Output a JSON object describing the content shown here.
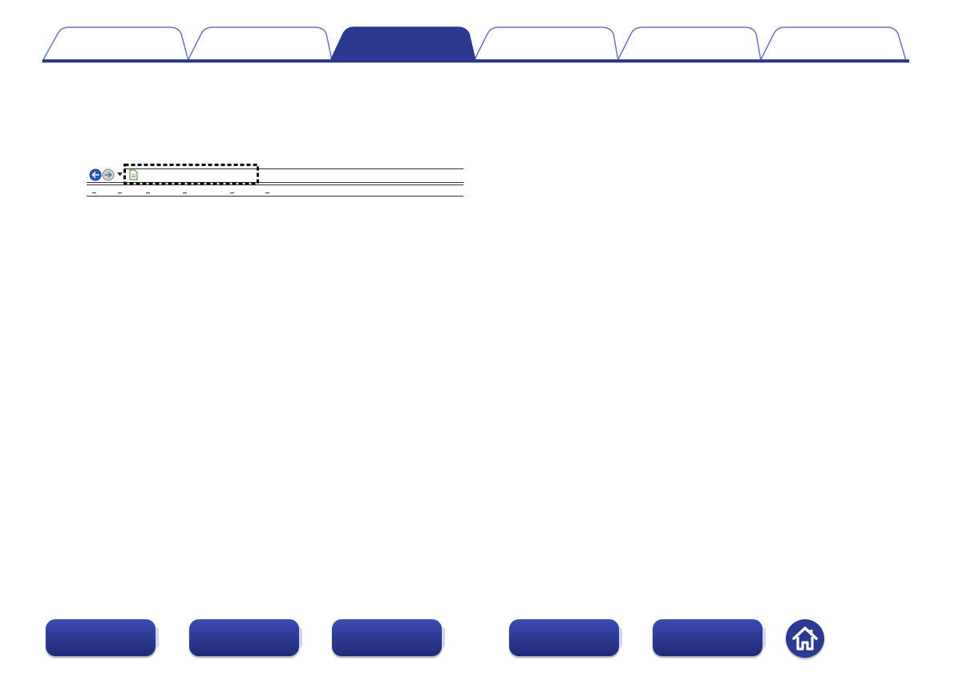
{
  "tabs": [
    {
      "label": "",
      "active": false
    },
    {
      "label": "",
      "active": false
    },
    {
      "label": "",
      "active": true
    },
    {
      "label": "",
      "active": false
    },
    {
      "label": "",
      "active": false
    },
    {
      "label": "",
      "active": false
    }
  ],
  "toolbar": {
    "back_icon": "back-arrow-icon",
    "forward_icon": "forward-arrow-icon",
    "dropdown_icon": "dropdown-triangle-icon",
    "page_icon": "page-icon",
    "address_value": "",
    "menu_items": [
      "",
      "",
      "",
      "",
      "",
      ""
    ]
  },
  "bottom_nav": [
    {
      "label": ""
    },
    {
      "label": ""
    },
    {
      "label": ""
    },
    {
      "label": ""
    },
    {
      "label": ""
    }
  ],
  "home": {
    "icon": "home-icon"
  },
  "colors": {
    "brand": "#2b3990",
    "tab_outline": "#6b74b8",
    "tab_fill": "#ffffff",
    "highlight_border": "#000000"
  }
}
